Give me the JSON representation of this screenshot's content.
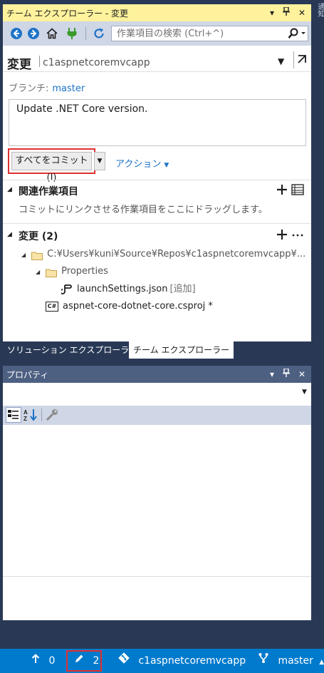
{
  "side": {
    "label": "通知"
  },
  "team_explorer": {
    "title": "チーム エクスプローラー - 変更",
    "search_placeholder": "作業項目の検索 (Ctrl+^)",
    "page_title": "変更",
    "repo": "c1aspnetcoremvcapp",
    "branch_label": "ブランチ:",
    "branch": "master",
    "commit_message": "Update .NET Core version.",
    "commit_button": "すべてをコミット(I)",
    "actions_label": "アクション",
    "related_title": "関連作業項目",
    "related_hint": "コミットにリンクさせる作業項目をここにドラッグします。",
    "changes_title": "変更 (2)",
    "tree": {
      "root_path": "C:¥Users¥kuni¥Source¥Repos¥c1aspnetcoremvcapp¥...",
      "properties": "Properties",
      "launch_settings": "launchSettings.json",
      "added_tag": "[追加]",
      "csproj": "aspnet-core-dotnet-core.csproj *",
      "cs_badge": "C#"
    }
  },
  "tabs": [
    {
      "label": "ソリューション エクスプローラー"
    },
    {
      "label": "チーム エクスプローラー"
    }
  ],
  "properties_panel": {
    "title": "プロパティ"
  },
  "status_bar": {
    "unpushed": "0",
    "pending": "2",
    "repo": "c1aspnetcoremvcapp",
    "branch": "master"
  },
  "colors": {
    "accent": "#007acc",
    "active_title": "#fff29d",
    "highlight": "#e03030",
    "link": "#1e73c8"
  }
}
